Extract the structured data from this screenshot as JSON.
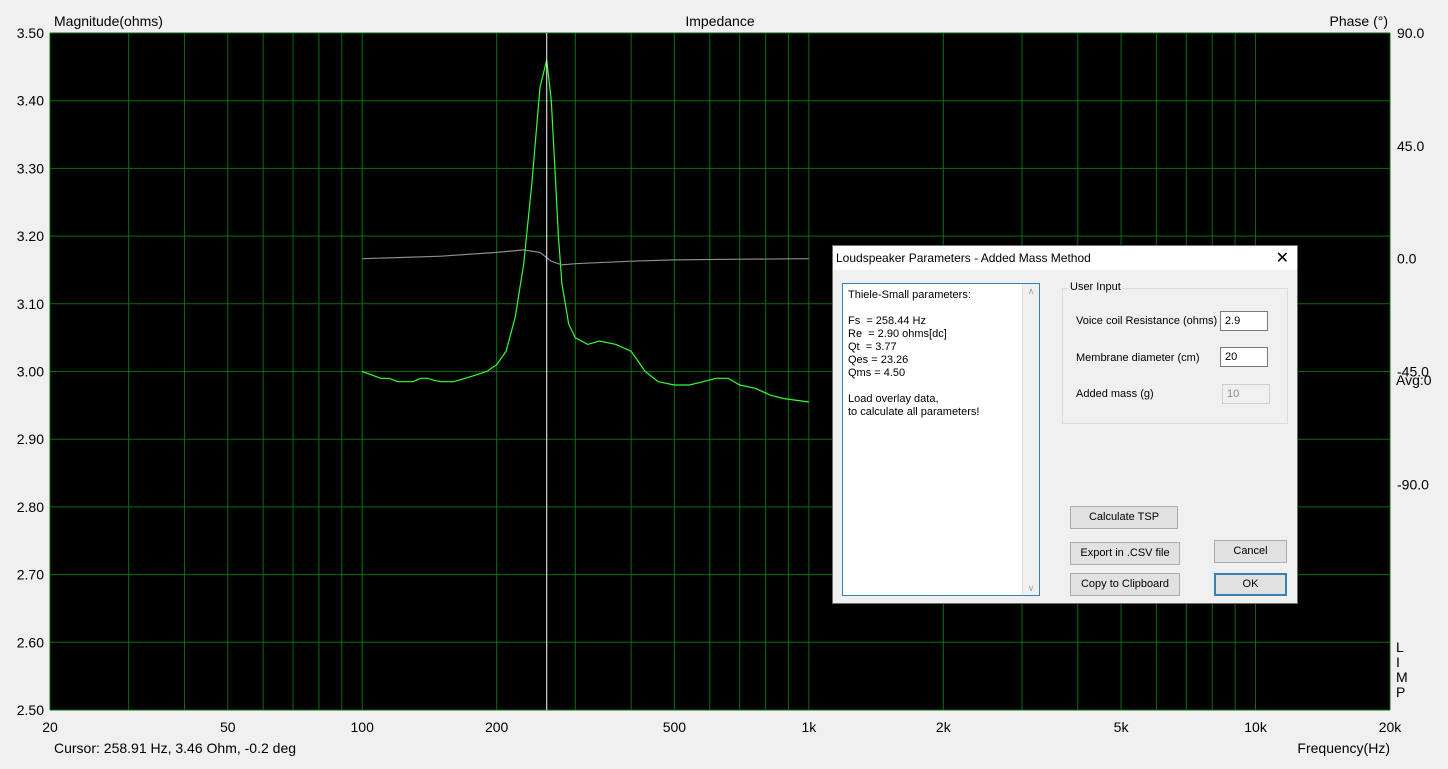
{
  "chart_data": {
    "type": "line",
    "title": "Impedance",
    "ylabel_left": "Magnitude(ohms)",
    "ylabel_right": "Phase (°)",
    "xlabel": "Frequency(Hz)",
    "xscale": "log",
    "xlim": [
      20,
      20000
    ],
    "ylim_left": [
      2.5,
      3.5
    ],
    "ylim_right": [
      -180,
      90
    ],
    "x_ticks": [
      20,
      50,
      100,
      200,
      500,
      1000,
      2000,
      5000,
      10000,
      20000
    ],
    "x_tick_labels": [
      "20",
      "50",
      "100",
      "200",
      "500",
      "1k",
      "2k",
      "5k",
      "10k",
      "20k"
    ],
    "y_ticks_left": [
      "3.50",
      "3.40",
      "3.30",
      "3.20",
      "3.10",
      "3.00",
      "2.90",
      "2.80",
      "2.70",
      "2.60",
      "2.50"
    ],
    "y_ticks_right": [
      "90.0",
      "45.0",
      "0.0",
      "-45.0",
      "-90.0"
    ],
    "y_ticks_right_values": [
      90,
      45,
      0,
      -45,
      -90
    ],
    "grid": true,
    "side_label": "Avg:0",
    "vertical_letters": [
      "L",
      "I",
      "M",
      "P"
    ],
    "cursor_x": 258.91,
    "cursor_readout": "Cursor: 258.91 Hz, 3.46 Ohm, -0.2 deg",
    "colors": {
      "background": "#000000",
      "grid": "#0a6e0a",
      "magnitude": "#33ff33",
      "phase": "#8c8c8c",
      "cursor": "#ffffff"
    },
    "series": [
      {
        "axis": "left",
        "x": [
          100,
          105,
          110,
          115,
          120,
          125,
          130,
          135,
          140,
          145,
          150,
          160,
          170,
          180,
          190,
          200,
          210,
          220,
          230,
          240,
          250,
          258.91,
          265,
          270,
          275,
          280,
          290,
          300,
          320,
          340,
          370,
          400,
          430,
          460,
          500,
          540,
          580,
          620,
          660,
          700,
          760,
          820,
          880,
          950,
          1000
        ],
        "values": [
          3.0,
          2.995,
          2.99,
          2.99,
          2.985,
          2.985,
          2.985,
          2.99,
          2.99,
          2.987,
          2.985,
          2.985,
          2.99,
          2.995,
          3.0,
          3.01,
          3.03,
          3.08,
          3.16,
          3.28,
          3.42,
          3.46,
          3.4,
          3.3,
          3.2,
          3.13,
          3.07,
          3.05,
          3.04,
          3.045,
          3.04,
          3.03,
          3.0,
          2.985,
          2.98,
          2.98,
          2.985,
          2.99,
          2.99,
          2.98,
          2.975,
          2.965,
          2.96,
          2.957,
          2.955
        ]
      },
      {
        "axis": "right",
        "x": [
          100,
          150,
          200,
          230,
          250,
          265,
          280,
          300,
          400,
          500,
          700,
          1000
        ],
        "values": [
          0.0,
          1.0,
          2.5,
          3.5,
          2.5,
          -1.0,
          -2.5,
          -2.0,
          -1.0,
          -0.5,
          -0.2,
          0.0
        ]
      }
    ]
  },
  "dialog": {
    "title": "Loudspeaker Parameters - Added Mass Method",
    "close_glyph": "✕",
    "tsp_text": "Thiele-Small parameters:\n\nFs  = 258.44 Hz\nRe  = 2.90 ohms[dc]\nQt  = 3.77\nQes = 23.26\nQms = 4.50\n\nLoad overlay data,\nto calculate all parameters!",
    "scroll_up": "∧",
    "scroll_down": "∨",
    "user_input_label": "User Input",
    "voice_coil_label": "Voice coil Resistance (ohms)",
    "voice_coil_value": "2.9",
    "membrane_label": "Membrane diameter (cm)",
    "membrane_value": "20",
    "added_mass_label": "Added mass (g)",
    "added_mass_value": "10",
    "calculate_button": "Calculate TSP",
    "export_button": "Export in .CSV file",
    "copy_button": "Copy to Clipboard",
    "cancel_button": "Cancel",
    "ok_button": "OK"
  }
}
